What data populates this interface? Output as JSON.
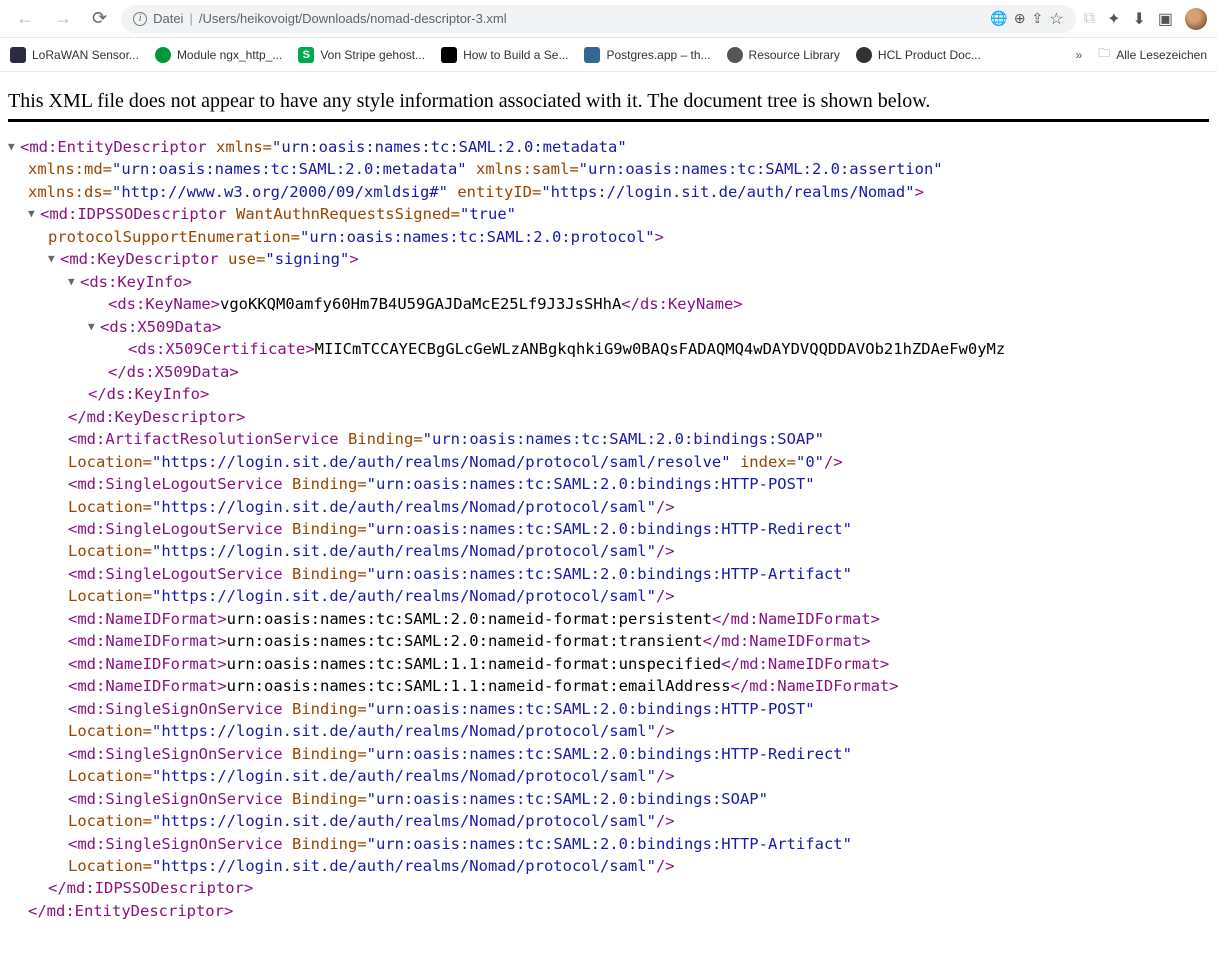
{
  "toolbar": {
    "url_prefix": "Datei",
    "url_path": "/Users/heikovoigt/Downloads/nomad-descriptor-3.xml"
  },
  "bookmarks": [
    {
      "label": "LoRaWAN Sensor...",
      "color": "#2b2b40"
    },
    {
      "label": "Module ngx_http_...",
      "color": "#009639"
    },
    {
      "label": "Von Stripe gehost...",
      "color": "#00a852"
    },
    {
      "label": "How to Build a Se...",
      "color": "#000000"
    },
    {
      "label": "Postgres.app – th...",
      "color": "#336791"
    },
    {
      "label": "Resource Library",
      "color": "#555555"
    },
    {
      "label": "HCL Product Doc...",
      "color": "#333333"
    }
  ],
  "bookmarks_all": "Alle Lesezeichen",
  "notice": "This XML file does not appear to have any style information associated with it. The document tree is shown below.",
  "xml": {
    "root": {
      "open": "md:EntityDescriptor",
      "attrs": [
        {
          "n": "xmlns",
          "v": "urn:oasis:names:tc:SAML:2.0:metadata"
        },
        {
          "n": "xmlns:md",
          "v": "urn:oasis:names:tc:SAML:2.0:metadata"
        },
        {
          "n": "xmlns:saml",
          "v": "urn:oasis:names:tc:SAML:2.0:assertion"
        },
        {
          "n": "xmlns:ds",
          "v": "http://www.w3.org/2000/09/xmldsig#"
        },
        {
          "n": "entityID",
          "v": "https://login.sit.de/auth/realms/Nomad"
        }
      ],
      "close": "md:EntityDescriptor"
    },
    "idp": {
      "open": "md:IDPSSODescriptor",
      "attrs": [
        {
          "n": "WantAuthnRequestsSigned",
          "v": "true"
        },
        {
          "n": "protocolSupportEnumeration",
          "v": "urn:oasis:names:tc:SAML:2.0:protocol"
        }
      ],
      "close": "md:IDPSSODescriptor"
    },
    "kd": {
      "open": "md:KeyDescriptor",
      "attr": {
        "n": "use",
        "v": "signing"
      },
      "close": "md:KeyDescriptor"
    },
    "ki": {
      "open": "ds:KeyInfo",
      "close": "ds:KeyInfo"
    },
    "kn": {
      "open": "ds:KeyName",
      "text": "vgoKKQM0amfy60Hm7B4U59GAJDaMcE25Lf9J3JsSHhA",
      "close": "ds:KeyName"
    },
    "xd": {
      "open": "ds:X509Data",
      "close": "ds:X509Data"
    },
    "xc": {
      "open": "ds:X509Certificate",
      "text": "MIICmTCCAYECBgGLcGeWLzANBgkqhkiG9w0BAQsFADAQMQ4wDAYDVQQDDAVOb21hZDAeFw0yMz",
      "close": "ds:X509Certificate"
    },
    "ars": {
      "open": "md:ArtifactResolutionService",
      "attrs": [
        {
          "n": "Binding",
          "v": "urn:oasis:names:tc:SAML:2.0:bindings:SOAP"
        },
        {
          "n": "Location",
          "v": "https://login.sit.de/auth/realms/Nomad/protocol/saml/resolve"
        },
        {
          "n": "index",
          "v": "0"
        }
      ]
    },
    "slo": [
      {
        "b": "urn:oasis:names:tc:SAML:2.0:bindings:HTTP-POST",
        "l": "https://login.sit.de/auth/realms/Nomad/protocol/saml"
      },
      {
        "b": "urn:oasis:names:tc:SAML:2.0:bindings:HTTP-Redirect",
        "l": "https://login.sit.de/auth/realms/Nomad/protocol/saml"
      },
      {
        "b": "urn:oasis:names:tc:SAML:2.0:bindings:HTTP-Artifact",
        "l": "https://login.sit.de/auth/realms/Nomad/protocol/saml"
      }
    ],
    "slo_tag": "md:SingleLogoutService",
    "nid_tag": "md:NameIDFormat",
    "nid": [
      "urn:oasis:names:tc:SAML:2.0:nameid-format:persistent",
      "urn:oasis:names:tc:SAML:2.0:nameid-format:transient",
      "urn:oasis:names:tc:SAML:1.1:nameid-format:unspecified",
      "urn:oasis:names:tc:SAML:1.1:nameid-format:emailAddress"
    ],
    "sso_tag": "md:SingleSignOnService",
    "sso": [
      {
        "b": "urn:oasis:names:tc:SAML:2.0:bindings:HTTP-POST",
        "l": "https://login.sit.de/auth/realms/Nomad/protocol/saml"
      },
      {
        "b": "urn:oasis:names:tc:SAML:2.0:bindings:HTTP-Redirect",
        "l": "https://login.sit.de/auth/realms/Nomad/protocol/saml"
      },
      {
        "b": "urn:oasis:names:tc:SAML:2.0:bindings:SOAP",
        "l": "https://login.sit.de/auth/realms/Nomad/protocol/saml"
      },
      {
        "b": "urn:oasis:names:tc:SAML:2.0:bindings:HTTP-Artifact",
        "l": "https://login.sit.de/auth/realms/Nomad/protocol/saml"
      }
    ],
    "labels": {
      "binding": "Binding",
      "location": "Location",
      "index": "index"
    }
  }
}
